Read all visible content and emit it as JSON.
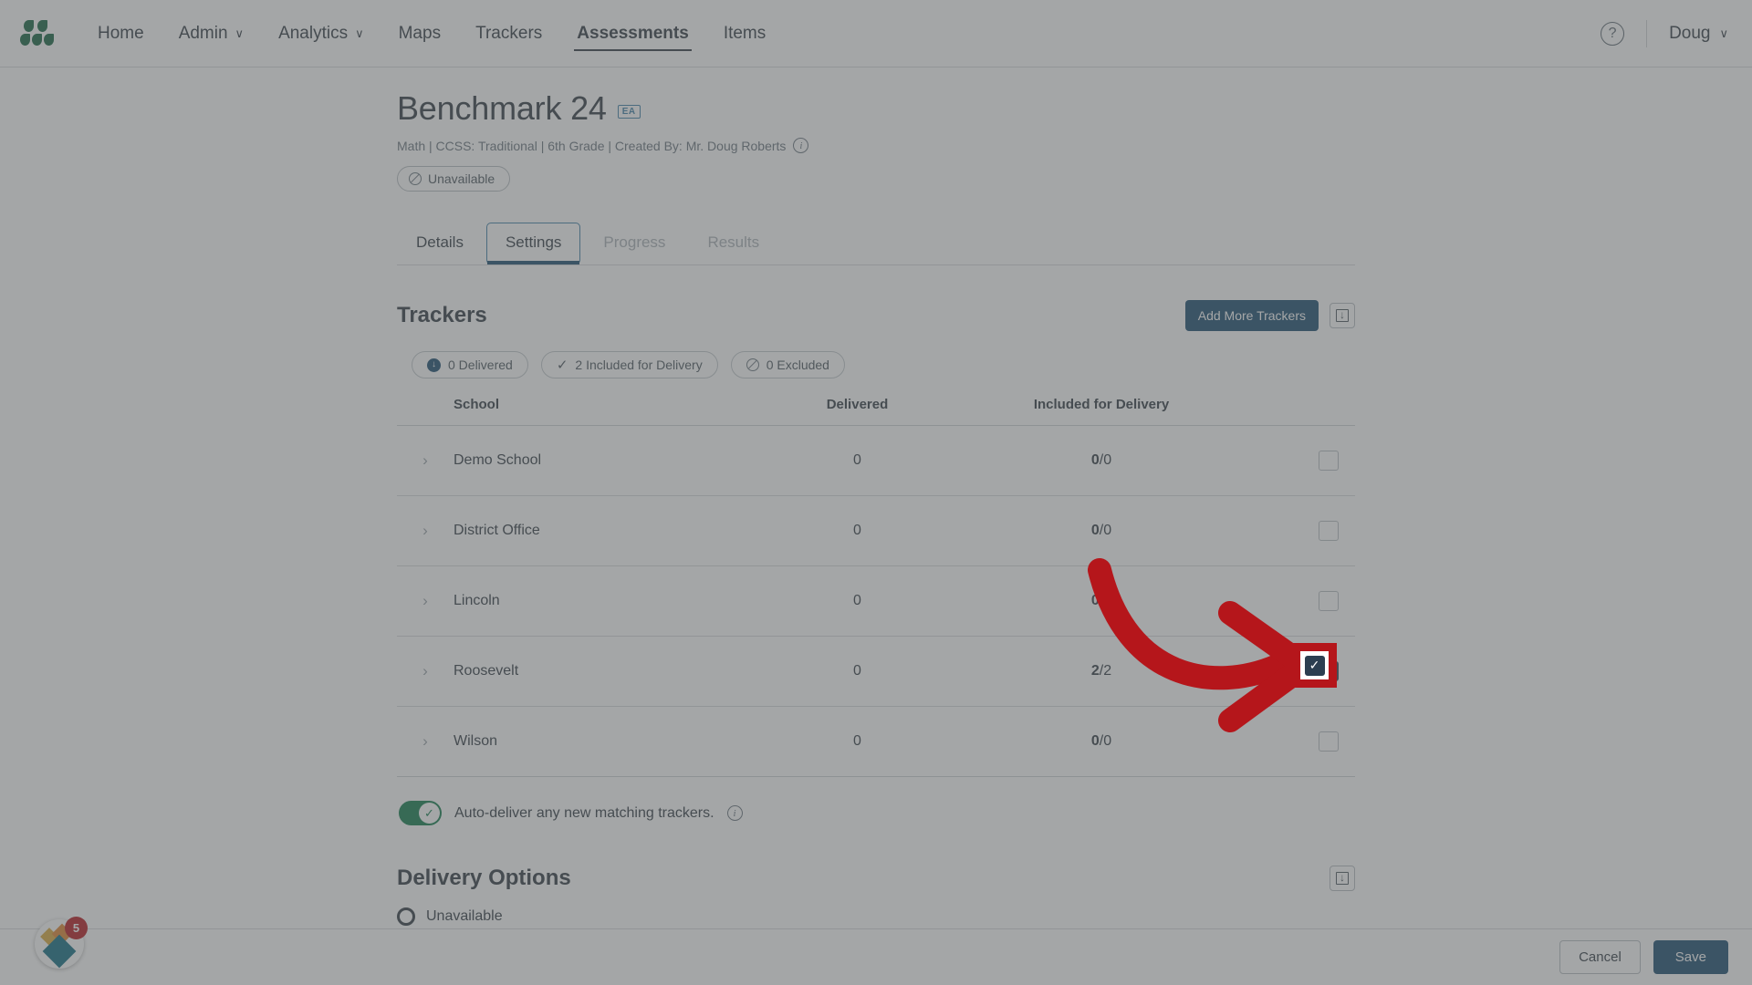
{
  "nav": {
    "logo_icon": "leaf-dots-logo",
    "items": [
      {
        "label": "Home",
        "has_caret": false,
        "active": false
      },
      {
        "label": "Admin",
        "has_caret": true,
        "active": false
      },
      {
        "label": "Analytics",
        "has_caret": true,
        "active": false
      },
      {
        "label": "Maps",
        "has_caret": false,
        "active": false
      },
      {
        "label": "Trackers",
        "has_caret": false,
        "active": false
      },
      {
        "label": "Assessments",
        "has_caret": false,
        "active": true
      },
      {
        "label": "Items",
        "has_caret": false,
        "active": false
      }
    ],
    "help_icon": "question-mark-icon",
    "help_glyph": "?",
    "user_name": "Doug",
    "caret_glyph": "∨"
  },
  "header": {
    "title": "Benchmark 24",
    "badge": "EA",
    "subtitle": "Math | CCSS: Traditional | 6th Grade | Created By: Mr. Doug Roberts",
    "info_icon": "info-icon",
    "info_glyph": "i",
    "status_label": "Unavailable",
    "status_icon": "ban-circle-icon"
  },
  "tabs": [
    {
      "label": "Details",
      "state": "enabled"
    },
    {
      "label": "Settings",
      "state": "active"
    },
    {
      "label": "Progress",
      "state": "disabled"
    },
    {
      "label": "Results",
      "state": "disabled"
    }
  ],
  "trackers": {
    "section_title": "Trackers",
    "add_button": "Add More Trackers",
    "collapse_icon": "collapse-down-icon",
    "pills": [
      {
        "label": "0 Delivered",
        "icon": "download-circle-icon"
      },
      {
        "label": "2 Included for Delivery",
        "icon": "check-icon"
      },
      {
        "label": "0 Excluded",
        "icon": "ban-circle-icon"
      }
    ],
    "columns": [
      "School",
      "Delivered",
      "Included for Delivery"
    ],
    "rows": [
      {
        "school": "Demo School",
        "delivered": "0",
        "included_num": "0",
        "included_den": "/0",
        "checked": false
      },
      {
        "school": "District Office",
        "delivered": "0",
        "included_num": "0",
        "included_den": "/0",
        "checked": false
      },
      {
        "school": "Lincoln",
        "delivered": "0",
        "included_num": "0",
        "included_den": "/0",
        "checked": false
      },
      {
        "school": "Roosevelt",
        "delivered": "0",
        "included_num": "2",
        "included_den": "/2",
        "checked": true
      },
      {
        "school": "Wilson",
        "delivered": "0",
        "included_num": "0",
        "included_den": "/0",
        "checked": false
      }
    ],
    "expander_glyph": "›",
    "check_glyph": "✓",
    "auto_deliver_label": "Auto-deliver any new matching trackers.",
    "auto_deliver_on": true
  },
  "delivery": {
    "section_title": "Delivery Options",
    "collapse_icon": "collapse-down-icon",
    "option_label": "Unavailable"
  },
  "footer": {
    "cancel_label": "Cancel",
    "save_label": "Save"
  },
  "fab": {
    "badge_count": "5",
    "icon": "diamond-stack-icon"
  },
  "colors": {
    "brand_green": "#12623f",
    "accent_blue": "#17496d",
    "tab_blue": "#3d7ea6",
    "toggle_green": "#0f7a4a",
    "checkbox_navy": "#2c3e50",
    "annotation_red": "#b5161b",
    "text_dark": "#2f3941",
    "text_muted": "#68737d"
  }
}
